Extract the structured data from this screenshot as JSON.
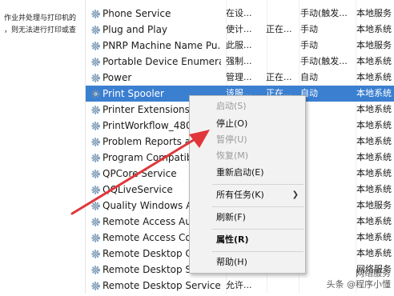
{
  "left_pane": {
    "description_line1": "作业并处理与打印机的",
    "description_line2": "，则无法进行打印或查"
  },
  "services": [
    {
      "name": "Phone Service",
      "desc": "在设...",
      "state": "",
      "start": "手动(触发...",
      "logon": "本地服务"
    },
    {
      "name": "Plug and Play",
      "desc": "使计...",
      "state": "正在...",
      "start": "手动",
      "logon": "本地系统"
    },
    {
      "name": "PNRP Machine Name Pu...",
      "desc": "此服...",
      "state": "",
      "start": "手动",
      "logon": "本地服务"
    },
    {
      "name": "Portable Device Enumera...",
      "desc": "强制...",
      "state": "",
      "start": "手动(触发...",
      "logon": "本地系统"
    },
    {
      "name": "Power",
      "desc": "管理...",
      "state": "正在...",
      "start": "自动",
      "logon": "本地系统"
    },
    {
      "name": "Print Spooler",
      "desc": "该服...",
      "state": "正在...",
      "start": "自动",
      "logon": "本地系统"
    },
    {
      "name": "Printer Extensions a",
      "desc": "",
      "state": "",
      "start": "",
      "logon": "本地系统"
    },
    {
      "name": "PrintWorkflow_480b",
      "desc": "",
      "state": "",
      "start": "",
      "logon": "本地系统"
    },
    {
      "name": "Problem Reports a",
      "desc": "",
      "state": "",
      "start": "",
      "logon": "本地系统"
    },
    {
      "name": "Program Compatibi",
      "desc": "",
      "state": "",
      "start": "",
      "logon": "本地系统"
    },
    {
      "name": "QPCore Service",
      "desc": "",
      "state": "",
      "start": "",
      "logon": "本地系统"
    },
    {
      "name": "QQLiveService",
      "desc": "",
      "state": "",
      "start": "",
      "logon": "本地系统"
    },
    {
      "name": "Quality Windows Au",
      "desc": "",
      "state": "",
      "start": "",
      "logon": "本地服务"
    },
    {
      "name": "Remote Access Auto",
      "desc": "",
      "state": "",
      "start": "",
      "logon": "本地系统"
    },
    {
      "name": "Remote Access Con",
      "desc": "",
      "state": "",
      "start": "",
      "logon": "本地系统"
    },
    {
      "name": "Remote Desktop Co",
      "desc": "",
      "state": "",
      "start": "",
      "logon": "本地系统"
    },
    {
      "name": "Remote Desktop Se",
      "desc": "",
      "state": "",
      "start": "",
      "logon": "网络服务"
    },
    {
      "name": "Remote Desktop Service...",
      "desc": "允许...",
      "state": "",
      "start": "",
      "logon": ""
    }
  ],
  "selected_row": 5,
  "context_menu": {
    "start": "启动(S)",
    "stop": "停止(O)",
    "pause": "暂停(U)",
    "resume": "恢复(M)",
    "restart": "重新启动(E)",
    "all_tasks": "所有任务(K)",
    "refresh": "刷新(F)",
    "properties": "属性(R)",
    "help": "帮助(H)"
  },
  "watermark": {
    "line1": "网络服务",
    "line2": "头条 @程序小懂"
  },
  "colors": {
    "selection": "#3b7fd1",
    "arrow": "#e0363a"
  }
}
